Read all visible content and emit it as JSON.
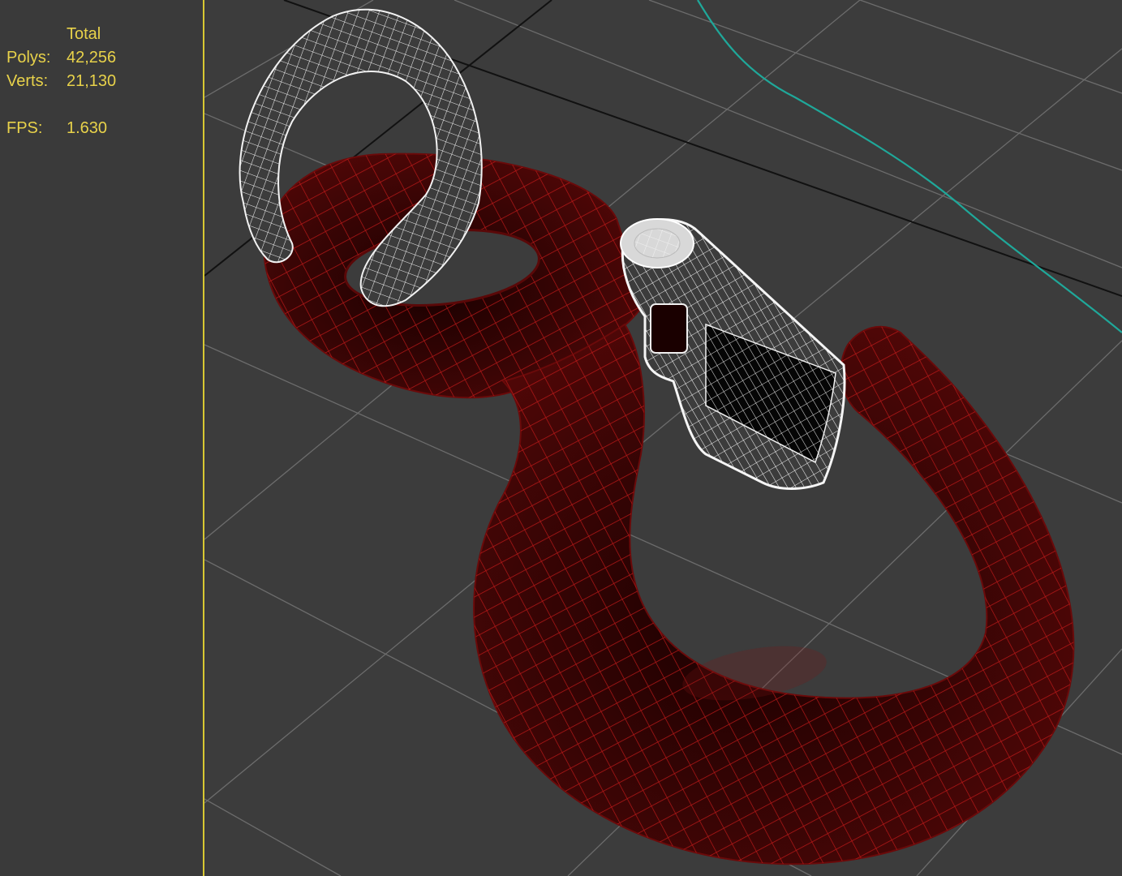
{
  "stats": {
    "header": "Total",
    "polys_label": "Polys:",
    "polys_value": "42,256",
    "verts_label": "Verts:",
    "verts_value": "21,130",
    "fps_label": "FPS:",
    "fps_value": "1.630"
  },
  "colors": {
    "viewport_bg": "#3c3c3c",
    "grid_line": "#6a6a6a",
    "grid_axis": "#111111",
    "active_border": "#d8c832",
    "stats_text": "#e8d24a",
    "spline": "#1fa89a",
    "hook_fill": "#3a0505",
    "hook_wire": "#c01818",
    "link_wire": "#f2f2f2"
  },
  "scene": {
    "objects": [
      "hook-mesh",
      "upper-link-wireframe",
      "latch-wireframe",
      "teal-spline"
    ]
  }
}
